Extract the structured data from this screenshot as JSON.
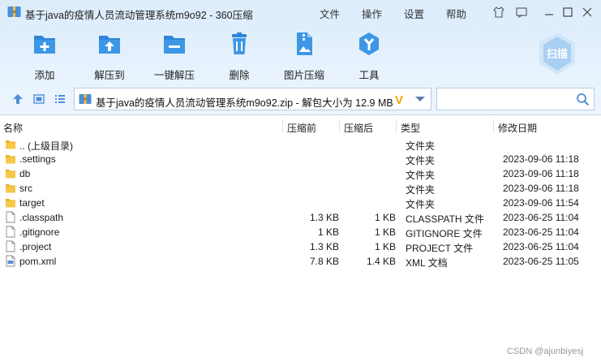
{
  "window": {
    "title": "基于java的疫情人员流动管理系统m9o92 - 360压缩",
    "menu": [
      "文件",
      "操作",
      "设置",
      "帮助"
    ]
  },
  "toolbar": {
    "buttons": [
      {
        "label": "添加",
        "icon": "add-icon"
      },
      {
        "label": "解压到",
        "icon": "extract-to-icon"
      },
      {
        "label": "一键解压",
        "icon": "one-click-extract-icon"
      },
      {
        "label": "删除",
        "icon": "delete-icon"
      },
      {
        "label": "图片压缩",
        "icon": "image-compress-icon"
      },
      {
        "label": "工具",
        "icon": "tools-icon"
      }
    ],
    "scan_label": "扫描"
  },
  "address": {
    "path": "基于java的疫情人员流动管理系统m9o92.zip - 解包大小为 12.9 MB",
    "badge": "V",
    "search_value": ""
  },
  "list": {
    "headers": {
      "name": "名称",
      "size": "压缩前",
      "compressed": "压缩后",
      "type": "类型",
      "date": "修改日期"
    },
    "rows": [
      {
        "name": ".. (上级目录)",
        "size": "",
        "compressed": "",
        "type": "文件夹",
        "date": "",
        "icon": "folder-icon"
      },
      {
        "name": ".settings",
        "size": "",
        "compressed": "",
        "type": "文件夹",
        "date": "2023-09-06 11:18",
        "icon": "folder-icon"
      },
      {
        "name": "db",
        "size": "",
        "compressed": "",
        "type": "文件夹",
        "date": "2023-09-06 11:18",
        "icon": "folder-icon"
      },
      {
        "name": "src",
        "size": "",
        "compressed": "",
        "type": "文件夹",
        "date": "2023-09-06 11:18",
        "icon": "folder-icon"
      },
      {
        "name": "target",
        "size": "",
        "compressed": "",
        "type": "文件夹",
        "date": "2023-09-06 11:54",
        "icon": "folder-icon"
      },
      {
        "name": ".classpath",
        "size": "1.3 KB",
        "compressed": "1 KB",
        "type": "CLASSPATH 文件",
        "date": "2023-06-25 11:04",
        "icon": "file-icon"
      },
      {
        "name": ".gitignore",
        "size": "1 KB",
        "compressed": "1 KB",
        "type": "GITIGNORE 文件",
        "date": "2023-06-25 11:04",
        "icon": "file-icon"
      },
      {
        "name": ".project",
        "size": "1.3 KB",
        "compressed": "1 KB",
        "type": "PROJECT 文件",
        "date": "2023-06-25 11:04",
        "icon": "file-icon"
      },
      {
        "name": "pom.xml",
        "size": "7.8 KB",
        "compressed": "1.4 KB",
        "type": "XML 文档",
        "date": "2023-06-25 11:05",
        "icon": "xml-file-icon"
      }
    ]
  },
  "watermark": "CSDN @ajunbiyesj"
}
